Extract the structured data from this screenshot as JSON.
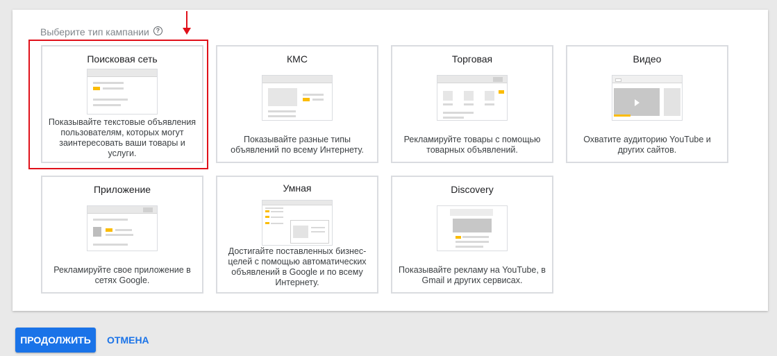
{
  "section": {
    "title": "Выберите тип кампании",
    "help_icon": "?"
  },
  "cards": {
    "search": {
      "title": "Поисковая сеть",
      "desc": "Показывайте текстовые объявления пользователям, которых могут заинтересовать ваши товары и услуги."
    },
    "kms": {
      "title": "КМС",
      "desc": "Показывайте разные типы объявлений по всему Интернету."
    },
    "shopping": {
      "title": "Торговая",
      "desc": "Рекламируйте товары с помощью товарных объявлений."
    },
    "video": {
      "title": "Видео",
      "desc": "Охватите аудиторию YouTube и других сайтов."
    },
    "app": {
      "title": "Приложение",
      "desc": "Рекламируйте свое приложение в сетях Google."
    },
    "smart": {
      "title": "Умная",
      "desc": "Достигайте поставленных бизнес-целей с помощью автоматических объявлений в Google и по всему Интернету."
    },
    "discovery": {
      "title": "Discovery",
      "desc": "Показывайте рекламу на YouTube, в Gmail и других сервисах."
    }
  },
  "actions": {
    "continue_label": "ПРОДОЛЖИТЬ",
    "cancel_label": "ОТМЕНА"
  },
  "colors": {
    "accent": "#1a73e8",
    "highlight": "#e0101a",
    "thumb_accent": "#fbbc04"
  }
}
